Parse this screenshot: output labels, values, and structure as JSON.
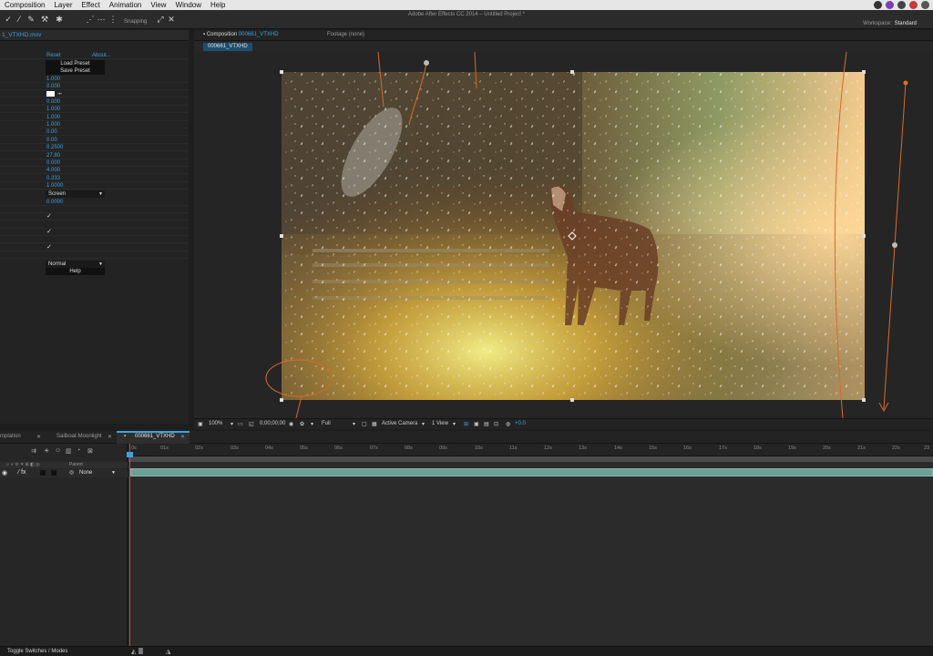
{
  "menubar": {
    "items": [
      "Composition",
      "Layer",
      "Effect",
      "Animation",
      "View",
      "Window",
      "Help"
    ],
    "tray_colors": [
      "#333333",
      "#7a3fb0",
      "#444444",
      "#c53a3a",
      "#555555"
    ]
  },
  "toolbar": {
    "app_title": "Adobe After Effects CC 2014 – Untitled Project *",
    "snapping_label": "Snapping",
    "workspace_label": "Workspace:",
    "workspace_value": "Standard"
  },
  "effect_controls": {
    "tab_label": "1_VTXHD.mov",
    "reset_label": "Reset",
    "about_label": "About...",
    "load_preset_label": "Load Preset",
    "save_preset_label": "Save Preset",
    "values": [
      "1.000",
      "0.000",
      "0.000",
      "1.000",
      "1.000",
      "1.000",
      "0.00",
      "0.00",
      "0.2500",
      "27.80",
      "0.000",
      "4.000",
      "0.333",
      "1.0000"
    ],
    "blend_mode": "Screen",
    "value_after_mode": "0.0000",
    "mode2": "Normal",
    "help_label": "Help"
  },
  "composition": {
    "tab_prefix": "Composition",
    "tab_name": "000661_VTXHD",
    "footage_tab": "Footage (none)",
    "breadcrumb": "000661_VTXHD",
    "footer": {
      "zoom": "100%",
      "timecode": "0;00;00;00",
      "resolution": "Full",
      "camera": "Active Camera",
      "view": "1 View",
      "exposure": "+0.0"
    }
  },
  "timeline": {
    "tabs": [
      "mplation",
      "Sailboat-Moonlight",
      "000661_VTXHD"
    ],
    "parent_header": "Parent",
    "parent_value": "None",
    "ruler_labels": [
      "0s",
      "01s",
      "02s",
      "03s",
      "04s",
      "05s",
      "06s",
      "07s",
      "08s",
      "09s",
      "10s",
      "11s",
      "12s",
      "13s",
      "14s",
      "15s",
      "16s",
      "17s",
      "18s",
      "19s",
      "20s",
      "21s",
      "22s",
      "23"
    ],
    "toggle_label": "Toggle Switches / Modes"
  }
}
